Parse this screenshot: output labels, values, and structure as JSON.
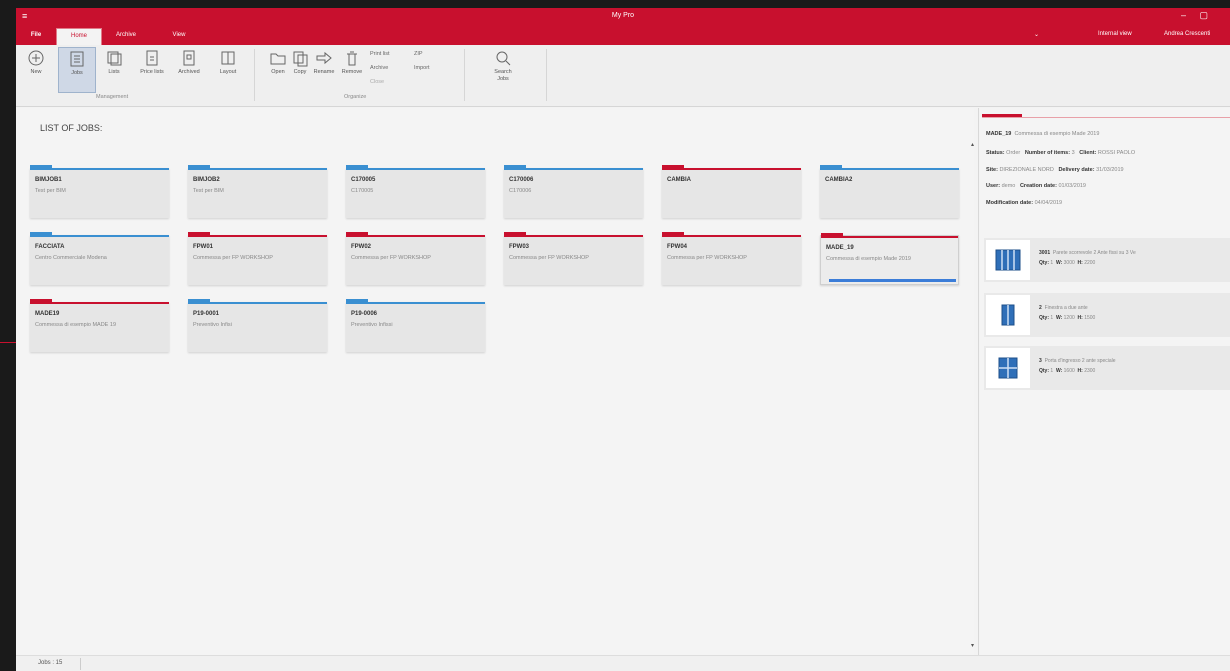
{
  "window": {
    "title": "My Pro"
  },
  "menu": {
    "tabs": [
      "File",
      "Home",
      "Archive",
      "View"
    ],
    "right": [
      "Internal view",
      "Andrea Crescenti"
    ]
  },
  "ribbon": {
    "buttons": [
      "New",
      "Jobs",
      "Lists",
      "Price lists",
      "Archived",
      "Layout",
      "Open",
      "Copy",
      "Rename",
      "Remove",
      "Search Jobs"
    ],
    "small": [
      "Print list",
      "ZIP",
      "Archive",
      "Import",
      "Close"
    ],
    "groups": [
      "Management",
      "Organize"
    ]
  },
  "list": {
    "title": "LIST OF JOBS:",
    "jobs": [
      {
        "name": "BIMJOB1",
        "desc": "Test per BIM",
        "color": "#3a8fd1"
      },
      {
        "name": "BIMJOB2",
        "desc": "Test per BIM",
        "color": "#3a8fd1"
      },
      {
        "name": "C170005",
        "desc": "C170005",
        "color": "#3a8fd1"
      },
      {
        "name": "C170006",
        "desc": "C170006",
        "color": "#3a8fd1"
      },
      {
        "name": "CAMBIA",
        "desc": "",
        "color": "#c8102e"
      },
      {
        "name": "CAMBIA2",
        "desc": "",
        "color": "#3a8fd1"
      },
      {
        "name": "FACCIATA",
        "desc": "Centro Commerciale Modena",
        "color": "#3a8fd1"
      },
      {
        "name": "FPW01",
        "desc": "Commessa per FP WORKSHOP",
        "color": "#c8102e"
      },
      {
        "name": "FPW02",
        "desc": "Commessa per FP WORKSHOP",
        "color": "#c8102e"
      },
      {
        "name": "FPW03",
        "desc": "Commessa per FP WORKSHOP",
        "color": "#c8102e"
      },
      {
        "name": "FPW04",
        "desc": "Commessa per FP WORKSHOP",
        "color": "#c8102e"
      },
      {
        "name": "MADE_19",
        "desc": "Commessa di esempio Made 2019",
        "color": "#c8102e"
      },
      {
        "name": "MADE19",
        "desc": "Commessa di esempio MADE 19",
        "color": "#c8102e"
      },
      {
        "name": "P19-0001",
        "desc": "Preventivo Infisi",
        "color": "#3a8fd1"
      },
      {
        "name": "P19-0006",
        "desc": "Preventivo Infissi",
        "color": "#3a8fd1"
      }
    ]
  },
  "status_bar": {
    "jobs_label": "Jobs : 15"
  },
  "detail": {
    "name": "MADE_19",
    "description": "Commessa di esempio Made 2019",
    "status_label": "Status:",
    "status": "Order",
    "items_label": "Number of items:",
    "items": "3",
    "client_label": "Client:",
    "client": "ROSSI PAOLO",
    "site_label": "Site:",
    "site": "DIREZIONALE NORD",
    "delivery_label": "Delivery date:",
    "delivery": "31/03/2019",
    "user_label": "User:",
    "user": "demo",
    "creation_label": "Creation date:",
    "creation": "01/03/2019",
    "modification_label": "Modification date:",
    "modification": "04/04/2019",
    "positions": [
      {
        "code": "3001",
        "text": "Parete scorrevole 2 Ante fissi su 3 Ve",
        "qty": "1",
        "w": "3000",
        "h": "2200"
      },
      {
        "code": "2",
        "text": "Finestra a due ante",
        "qty": "1",
        "w": "1200",
        "h": "1500"
      },
      {
        "code": "3",
        "text": "Porta d'ingresso 2 ante speciale",
        "qty": "1",
        "w": "1600",
        "h": "2300"
      }
    ],
    "qty_label": "Qty:",
    "w_label": "W:",
    "h_label": "H:"
  }
}
